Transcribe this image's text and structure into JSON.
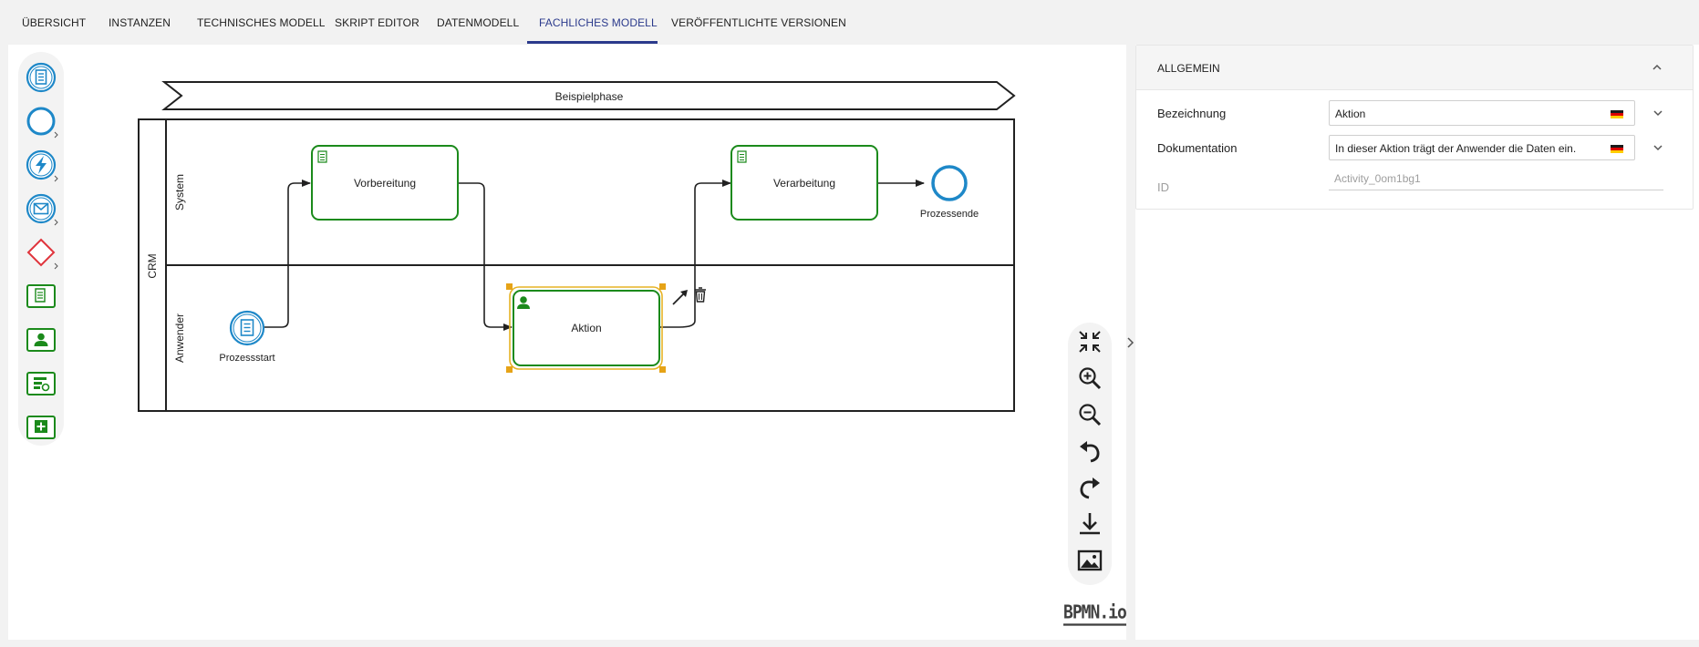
{
  "tabs": [
    {
      "label": "ÜBERSICHT",
      "active": false
    },
    {
      "label": "INSTANZEN",
      "active": false
    },
    {
      "label": "TECHNISCHES MODELL",
      "active": false
    },
    {
      "label": "SKRIPT EDITOR",
      "active": false
    },
    {
      "label": "DATENMODELL",
      "active": false
    },
    {
      "label": "FACHLICHES MODELL",
      "active": true
    },
    {
      "label": "VERÖFFENTLICHTE VERSIONEN",
      "active": false
    }
  ],
  "palette": {
    "items": [
      "start-event-tool",
      "end-event-tool",
      "signal-event-tool",
      "message-event-tool",
      "gateway-tool",
      "script-task-tool",
      "user-task-tool",
      "service-task-tool",
      "subprocess-tool"
    ]
  },
  "diagram": {
    "phase": "Beispielphase",
    "pool": "CRM",
    "lanes": [
      "System",
      "Anwender"
    ],
    "tasks": {
      "vorbereitung": "Vorbereitung",
      "verarbeitung": "Verarbeitung",
      "aktion": "Aktion"
    },
    "events": {
      "start": "Prozessstart",
      "end": "Prozessende"
    }
  },
  "zoombar": {
    "items": [
      "fit-viewport",
      "zoom-in",
      "zoom-out",
      "undo",
      "redo",
      "download",
      "export-image"
    ]
  },
  "logo": "BPMN.io",
  "properties": {
    "section_title": "ALLGEMEIN",
    "fields": {
      "bezeichnung_label": "Bezeichnung",
      "bezeichnung_value": "Aktion",
      "dokumentation_label": "Dokumentation",
      "dokumentation_value": "In dieser Aktion trägt der Anwender die Daten ein.",
      "id_label": "ID",
      "id_value": "Activity_0om1bg1"
    }
  },
  "colors": {
    "accent": "#2b3a8c",
    "task_green": "#1b8a1b",
    "event_blue": "#1e88c8",
    "gateway_red": "#e0343c",
    "selection": "#e6b325"
  }
}
